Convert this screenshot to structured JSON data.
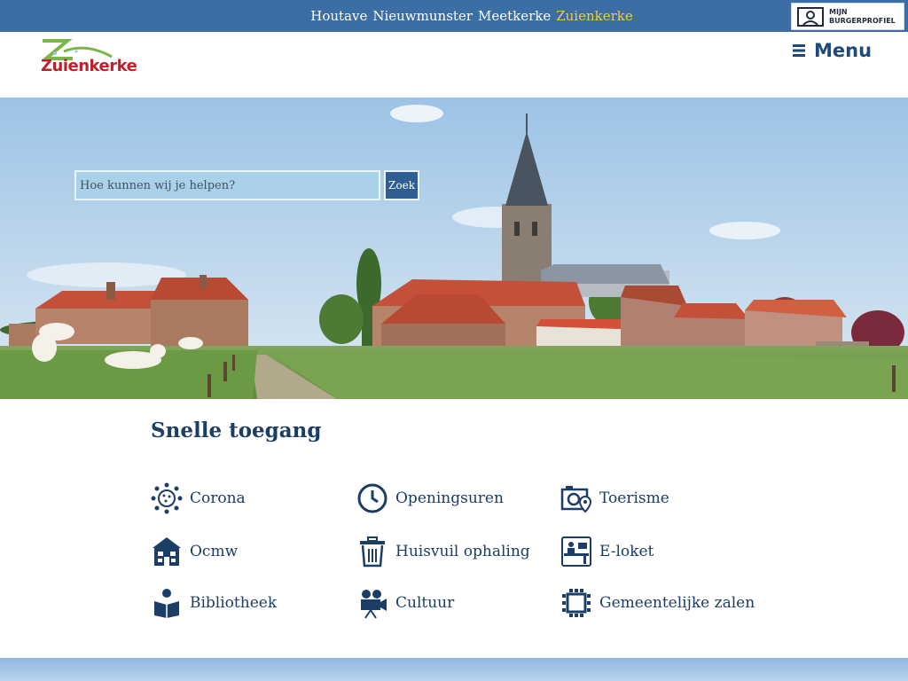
{
  "topbar": {
    "villages": [
      "Houtave",
      "Nieuwmunster",
      "Meetkerke",
      "Zuienkerke"
    ],
    "profile_line1": "MIJN",
    "profile_line2": "BURGERPROFIEL"
  },
  "header": {
    "logo_text": "Zuienkerke",
    "menu_label": "Menu"
  },
  "search": {
    "placeholder": "Hoe kunnen wij je helpen?",
    "button": "Zoek"
  },
  "quick_access": {
    "title": "Snelle toegang",
    "items": [
      {
        "label": "Corona",
        "icon": "virus-icon"
      },
      {
        "label": "Openingsuren",
        "icon": "clock-icon"
      },
      {
        "label": "Toerisme",
        "icon": "camera-location-icon"
      },
      {
        "label": "Ocmw",
        "icon": "house-icon"
      },
      {
        "label": "Huisvuil ophaling",
        "icon": "trash-icon"
      },
      {
        "label": "E-loket",
        "icon": "counter-desk-icon"
      },
      {
        "label": "Bibliotheek",
        "icon": "book-reader-icon"
      },
      {
        "label": "Cultuur",
        "icon": "film-camera-icon"
      },
      {
        "label": "Gemeentelijke zalen",
        "icon": "meeting-room-icon"
      }
    ]
  },
  "colors": {
    "topbar": "#3a6ea5",
    "active_village": "#f2c94c",
    "link": "#1b3d66",
    "search_button": "#2f5f92"
  }
}
